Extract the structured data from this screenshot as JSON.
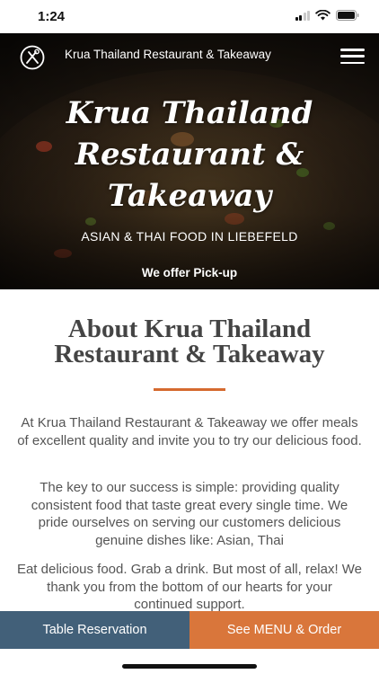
{
  "status_bar": {
    "time": "1:24",
    "icons": [
      "cellular-signal-icon",
      "wifi-icon",
      "battery-icon"
    ]
  },
  "header": {
    "logo_icon": "plate-fork-knife-icon",
    "brand": "Krua Thailand Restaurant & Takeaway",
    "menu_icon": "hamburger-menu-icon"
  },
  "hero": {
    "title_lines": [
      "Krua Thailand",
      "Restaurant &",
      "Takeaway"
    ],
    "subtitle": "ASIAN & THAI FOOD IN LIEBEFELD",
    "pickup": "We offer Pick-up"
  },
  "about": {
    "title_lines": [
      "About Krua Thailand",
      "Restaurant & Takeaway"
    ],
    "paragraphs": [
      "At Krua Thailand Restaurant & Takeaway we offer meals of excellent quality and invite you to try our delicious food.",
      "The key to our success is simple: providing quality consistent food that taste great every single time. We pride ourselves on serving our customers delicious genuine dishes like: Asian, Thai",
      "Eat delicious food. Grab a drink. But most of all, relax! We thank you from the bottom of our hearts for your continued support."
    ]
  },
  "actions": {
    "reservation_label": "Table Reservation",
    "menu_label": "See MENU & Order"
  },
  "colors": {
    "accent": "#d56a2f",
    "reservation_button": "#426079",
    "menu_button": "#d9763b"
  }
}
